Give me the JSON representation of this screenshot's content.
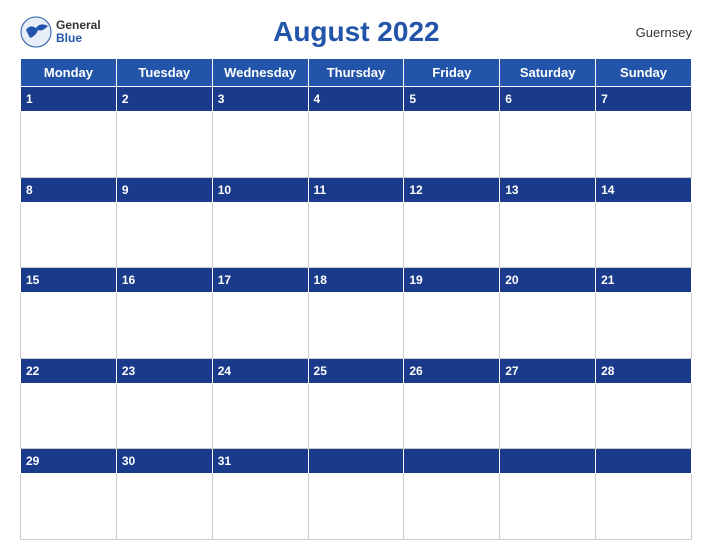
{
  "header": {
    "title": "August 2022",
    "country": "Guernsey",
    "logo_general": "General",
    "logo_blue": "Blue"
  },
  "days": [
    "Monday",
    "Tuesday",
    "Wednesday",
    "Thursday",
    "Friday",
    "Saturday",
    "Sunday"
  ],
  "weeks": [
    {
      "dates": [
        "1",
        "2",
        "3",
        "4",
        "5",
        "6",
        "7"
      ]
    },
    {
      "dates": [
        "8",
        "9",
        "10",
        "11",
        "12",
        "13",
        "14"
      ]
    },
    {
      "dates": [
        "15",
        "16",
        "17",
        "18",
        "19",
        "20",
        "21"
      ]
    },
    {
      "dates": [
        "22",
        "23",
        "24",
        "25",
        "26",
        "27",
        "28"
      ]
    },
    {
      "dates": [
        "29",
        "30",
        "31",
        "",
        "",
        "",
        ""
      ]
    }
  ],
  "colors": {
    "header_blue": "#1e4da1",
    "date_blue": "#2255aa",
    "border": "#ccc"
  }
}
